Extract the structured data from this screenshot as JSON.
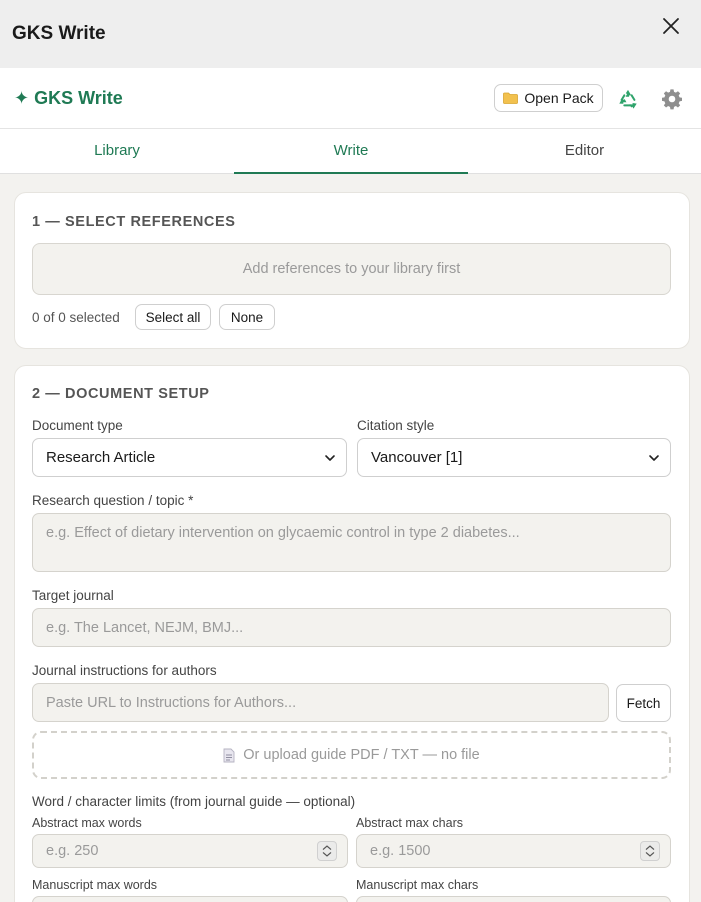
{
  "titlebar": {
    "title": "GKS Write"
  },
  "header": {
    "brand": "GKS Write",
    "open_pack_label": "Open Pack"
  },
  "tabs": [
    {
      "label": "Library"
    },
    {
      "label": "Write"
    },
    {
      "label": "Editor"
    }
  ],
  "section1": {
    "title": "1 — SELECT REFERENCES",
    "empty_text": "Add references to your library first",
    "selected_count": "0 of 0 selected",
    "select_all_label": "Select all",
    "none_label": "None"
  },
  "section2": {
    "title": "2 — DOCUMENT SETUP",
    "document_type_label": "Document type",
    "document_type_value": "Research Article",
    "citation_style_label": "Citation style",
    "citation_style_value": "Vancouver [1]",
    "research_question_label": "Research question / topic *",
    "research_question_placeholder": "e.g. Effect of dietary intervention on glycaemic control in type 2 diabetes...",
    "target_journal_label": "Target journal",
    "target_journal_placeholder": "e.g. The Lancet, NEJM, BMJ...",
    "journal_instructions_label": "Journal instructions for authors",
    "journal_instructions_placeholder": "Paste URL to Instructions for Authors...",
    "fetch_label": "Fetch",
    "upload_text": "Or upload guide PDF / TXT — no file",
    "limits_label": "Word / character limits (from journal guide — optional)",
    "abstract_words_label": "Abstract max words",
    "abstract_words_placeholder": "e.g. 250",
    "abstract_chars_label": "Abstract max chars",
    "abstract_chars_placeholder": "e.g. 1500",
    "manuscript_words_label": "Manuscript max words",
    "manuscript_chars_label": "Manuscript max chars"
  },
  "colors": {
    "accent": "#1f7a54",
    "background": "#f3f2ef",
    "field_bg": "#f3f2ee"
  },
  "icons": {
    "close": "close-icon",
    "folder": "folder-icon",
    "recycle": "recycle-icon",
    "gear": "gear-icon",
    "document": "document-icon"
  }
}
